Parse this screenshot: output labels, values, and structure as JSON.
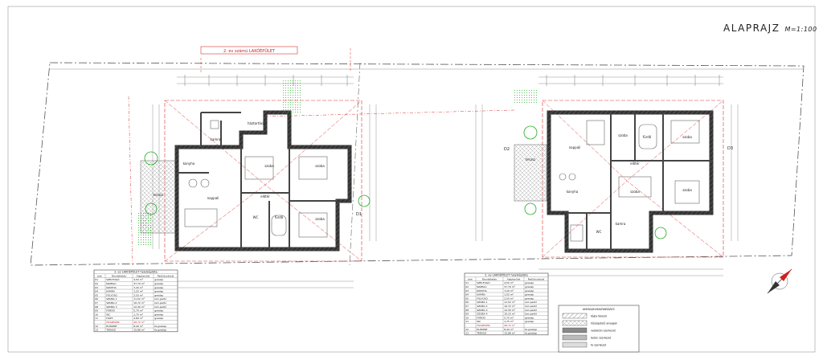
{
  "sheet": {
    "title": "ALAPRAJZ",
    "scale": "M=1:100",
    "unit_label_top": "2. ev számú LAKÓÉPÜLET"
  },
  "house_a": {
    "rooms": [
      "konyha",
      "nappali",
      "szoba",
      "szoba",
      "szoba",
      "fürdő",
      "WC",
      "előtér",
      "kamra",
      "háztartási",
      "terasz"
    ]
  },
  "house_b": {
    "rooms": [
      "nappali",
      "konyha",
      "szoba",
      "szoba",
      "szoba",
      "szoba",
      "fürdő",
      "WC",
      "előtér",
      "kamra",
      "terasz"
    ]
  },
  "schedule_left": {
    "title": "2. ev LAKÓÉPÜLET helyiséglista",
    "headers": [
      "jele",
      "Rendeltetés",
      "Alapterület",
      "Padlóburkolat"
    ],
    "rows": [
      [
        "01",
        "SZÉLFOGÓ",
        "4,50  m²",
        "greslap"
      ],
      [
        "02",
        "NAPPALI",
        "37,79  m²",
        "greslap"
      ],
      [
        "03",
        "KONYHA",
        "7,20  m²",
        "greslap"
      ],
      [
        "04",
        "KAMRA",
        "1,55  m²",
        "greslap"
      ],
      [
        "05",
        "FOLYOSO",
        "2,50  m²",
        "greslap"
      ],
      [
        "06",
        "SZOBA 1",
        "11,52  m²",
        "lam.padló"
      ],
      [
        "07",
        "SZOBA 2",
        "10,72  m²",
        "lam.padló"
      ],
      [
        "08",
        "SZOBA 3",
        "12,30  m²",
        "lam.padló"
      ],
      [
        "09",
        "FÜRDŐ",
        "5,70  m²",
        "greslap"
      ],
      [
        "10",
        "WC",
        "1,75  m²",
        "greslap"
      ],
      [
        "11",
        "HÁZT.",
        "2,80  m²",
        "greslap"
      ],
      [
        "",
        "ÖSSZESEN:",
        "98,70  m²",
        ""
      ],
      [
        "12",
        "ELŐKERT",
        "8,40  m²",
        "fa.greslap"
      ],
      [
        "13",
        "TERASZ",
        "15,88  m²",
        "fa.greslap"
      ]
    ]
  },
  "schedule_right": {
    "title": "2. ev LAKÓÉPÜLET helyiséglista",
    "headers": [
      "jele",
      "Rendeltetés",
      "Alapterület",
      "Padlóburkolat"
    ],
    "rows": [
      [
        "01",
        "SZÉLFOGÓ",
        "4,50  m²",
        "greslap"
      ],
      [
        "02",
        "NAPPALI",
        "37,79  m²",
        "greslap"
      ],
      [
        "03",
        "KONYHA",
        "7,20  m²",
        "greslap"
      ],
      [
        "04",
        "KAMRA",
        "1,55  m²",
        "greslap"
      ],
      [
        "05",
        "FOLYOSO",
        "2,50  m²",
        "greslap"
      ],
      [
        "06",
        "SZOBA 1",
        "11,52  m²",
        "lam.padló"
      ],
      [
        "07",
        "SZOBA 2",
        "10,72  m²",
        "lam.padló"
      ],
      [
        "08",
        "SZOBA 3",
        "12,30  m²",
        "lam.padló"
      ],
      [
        "09",
        "SZOBA 4",
        "10,10  m²",
        "lam.padló"
      ],
      [
        "10",
        "FÜRDŐ",
        "5,70  m²",
        "greslap"
      ],
      [
        "11",
        "WC",
        "1,75  m²",
        "greslap"
      ],
      [
        "",
        "ÖSSZESEN:",
        "98,70  m²",
        ""
      ],
      [
        "12",
        "ELŐKERT",
        "8,40  m²",
        "fa.greslap"
      ],
      [
        "13",
        "TERASZ",
        "15,88  m²",
        "fa.greslap"
      ]
    ]
  },
  "legend": {
    "title": "ANYAGJELMAGYARÁZAT:",
    "items": [
      "tégla falazat",
      "hőszigetelő anyagok",
      "vasbeton szerkezet",
      "beton szerkezet",
      "fa szerkezet"
    ]
  },
  "markers": [
    "D1",
    "D2",
    "D3"
  ]
}
